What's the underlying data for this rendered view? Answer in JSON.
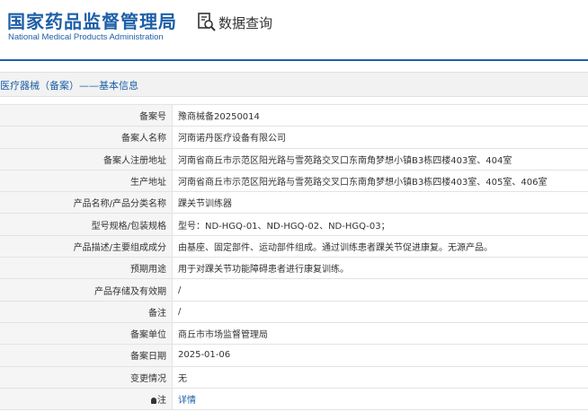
{
  "header": {
    "logo_cn": "国家药品监督管理局",
    "logo_en": "National Medical Products Administration",
    "query_label": "数据查询",
    "query_icon": "search-document-icon"
  },
  "subtitle": "医疗器械（备案）——基本信息",
  "rows": [
    {
      "label": "备案号",
      "value": "豫商械备20250014"
    },
    {
      "label": "备案人名称",
      "value": "河南诺丹医疗设备有限公司"
    },
    {
      "label": "备案人注册地址",
      "value": "河南省商丘市示范区阳光路与雪苑路交叉口东南角梦想小镇B3栋四楼403室、404室"
    },
    {
      "label": "生产地址",
      "value": "河南省商丘市示范区阳光路与雪苑路交叉口东南角梦想小镇B3栋四楼403室、405室、406室"
    },
    {
      "label": "产品名称/产品分类名称",
      "value": "踝关节训练器"
    },
    {
      "label": "型号规格/包装规格",
      "value": "型号：ND-HGQ-01、ND-HGQ-02、ND-HGQ-03；"
    },
    {
      "label": "产品描述/主要组成成分",
      "value": "由基座、固定部件、运动部件组成。通过训练患者踝关节促进康复。无源产品。"
    },
    {
      "label": "预期用途",
      "value": "用于对踝关节功能障碍患者进行康复训练。"
    },
    {
      "label": "产品存储及有效期",
      "value": "/"
    },
    {
      "label": "备注",
      "value": "/"
    },
    {
      "label": "备案单位",
      "value": "商丘市市场监督管理局"
    },
    {
      "label": "备案日期",
      "value": "2025-01-06"
    },
    {
      "label": "变更情况",
      "value": "无"
    }
  ],
  "note": {
    "label": "注",
    "icon": "lightbulb-icon",
    "link_text": "详情"
  },
  "colors": {
    "brand": "#1d5fa8",
    "label_bg": "#f5f5f5"
  }
}
